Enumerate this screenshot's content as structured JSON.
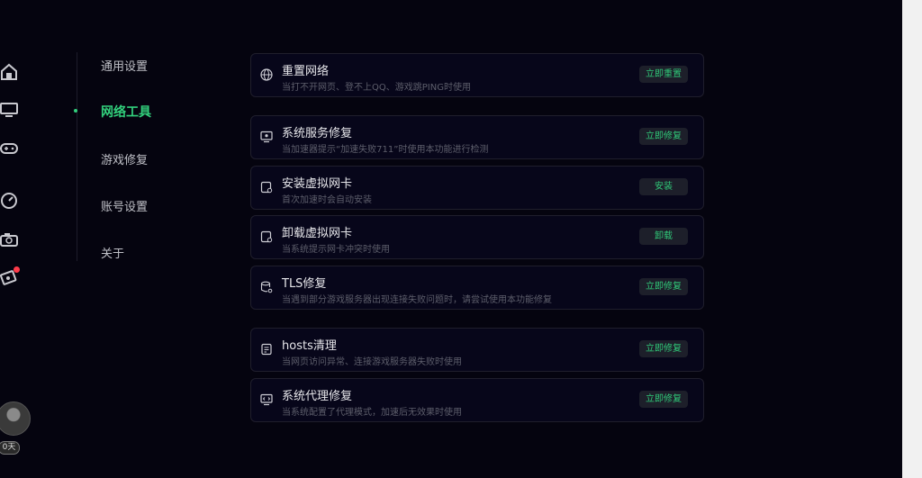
{
  "nav": {
    "items": [
      {
        "label": "通用设置"
      },
      {
        "label": "网络工具"
      },
      {
        "label": "游戏修复"
      },
      {
        "label": "账号设置"
      },
      {
        "label": "关于"
      }
    ],
    "active_index": 1
  },
  "rail": {
    "icons": [
      "home-icon",
      "monitor-icon",
      "gamepad-icon",
      "speedometer-icon",
      "camera-icon",
      "ticket-icon"
    ],
    "avatar_badge": "0天"
  },
  "tools": [
    {
      "icon": "globe-icon",
      "title": "重置网络",
      "desc": "当打不开网页、登不上QQ、游戏跳PING时使用",
      "button": "立即重置"
    },
    {
      "icon": "monitor-repair-icon",
      "title": "系统服务修复",
      "desc": "当加速器提示“加速失败711”时使用本功能进行检测",
      "button": "立即修复"
    },
    {
      "icon": "network-card-icon",
      "title": "安装虚拟网卡",
      "desc": "首次加速时会自动安装",
      "button": "安装"
    },
    {
      "icon": "network-card-icon",
      "title": "卸载虚拟网卡",
      "desc": "当系统提示网卡冲突时使用",
      "button": "卸载"
    },
    {
      "icon": "database-gear-icon",
      "title": "TLS修复",
      "desc": "当遇到部分游戏服务器出现连接失败问题时，请尝试使用本功能修复",
      "button": "立即修复"
    },
    {
      "icon": "hosts-file-icon",
      "title": "hosts清理",
      "desc": "当网页访问异常、连接游戏服务器失败时使用",
      "button": "立即修复"
    },
    {
      "icon": "screen-proxy-icon",
      "title": "系统代理修复",
      "desc": "当系统配置了代理模式，加速后无效果时使用",
      "button": "立即修复"
    }
  ],
  "colors": {
    "accent": "#32d07c",
    "background": "#05040f",
    "card_border": "#1f1e2c",
    "badge_red": "#ff3b4a"
  }
}
